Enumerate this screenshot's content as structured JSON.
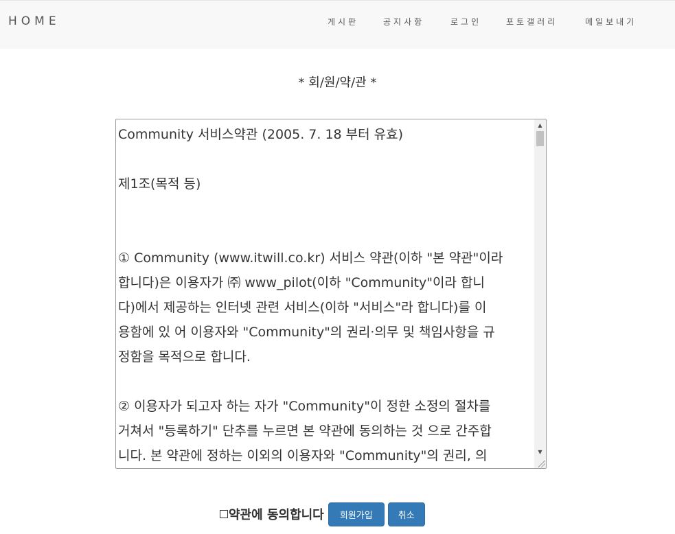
{
  "navbar": {
    "brand": "HOME",
    "items": [
      {
        "label": "게시판"
      },
      {
        "label": "공지사항"
      },
      {
        "label": "로그인"
      },
      {
        "label": "포토갤러리"
      },
      {
        "label": "메일보내기"
      }
    ]
  },
  "page_title": "* 회/원/약/관 *",
  "terms": {
    "line1": "Community 서비스약관 (2005. 7. 18 부터 유효)",
    "line2": "제1조(목적 등)",
    "line3": "① Community (www.itwill.co.kr) 서비스 약관(이하 \"본 약관\"이라",
    "line4": "합니다)은 이용자가 ㈜ www_pilot(이하 \"Community\"이라 합니",
    "line5": "다)에서 제공하는 인터넷 관련 서비스(이하 \"서비스\"라 합니다)를 이",
    "line6": "용함에 있 어 이용자와 \"Community\"의 권리·의무 및 책임사항을 규",
    "line7": "정함을 목적으로 합니다.",
    "line8": "② 이용자가 되고자 하는 자가 \"Community\"이 정한 소정의 절차를",
    "line9": "거쳐서 \"등록하기\" 단추를 누르면 본 약관에 동의하는 것 으로 간주합",
    "line10": "니다. 본 약관에 정하는 이외의 이용자와 \"Community\"의 권리, 의"
  },
  "agree": {
    "label": "약관에 동의합니다",
    "checked": false
  },
  "buttons": {
    "join": "회원가입",
    "cancel": "취소",
    "color": "#337ab7"
  }
}
